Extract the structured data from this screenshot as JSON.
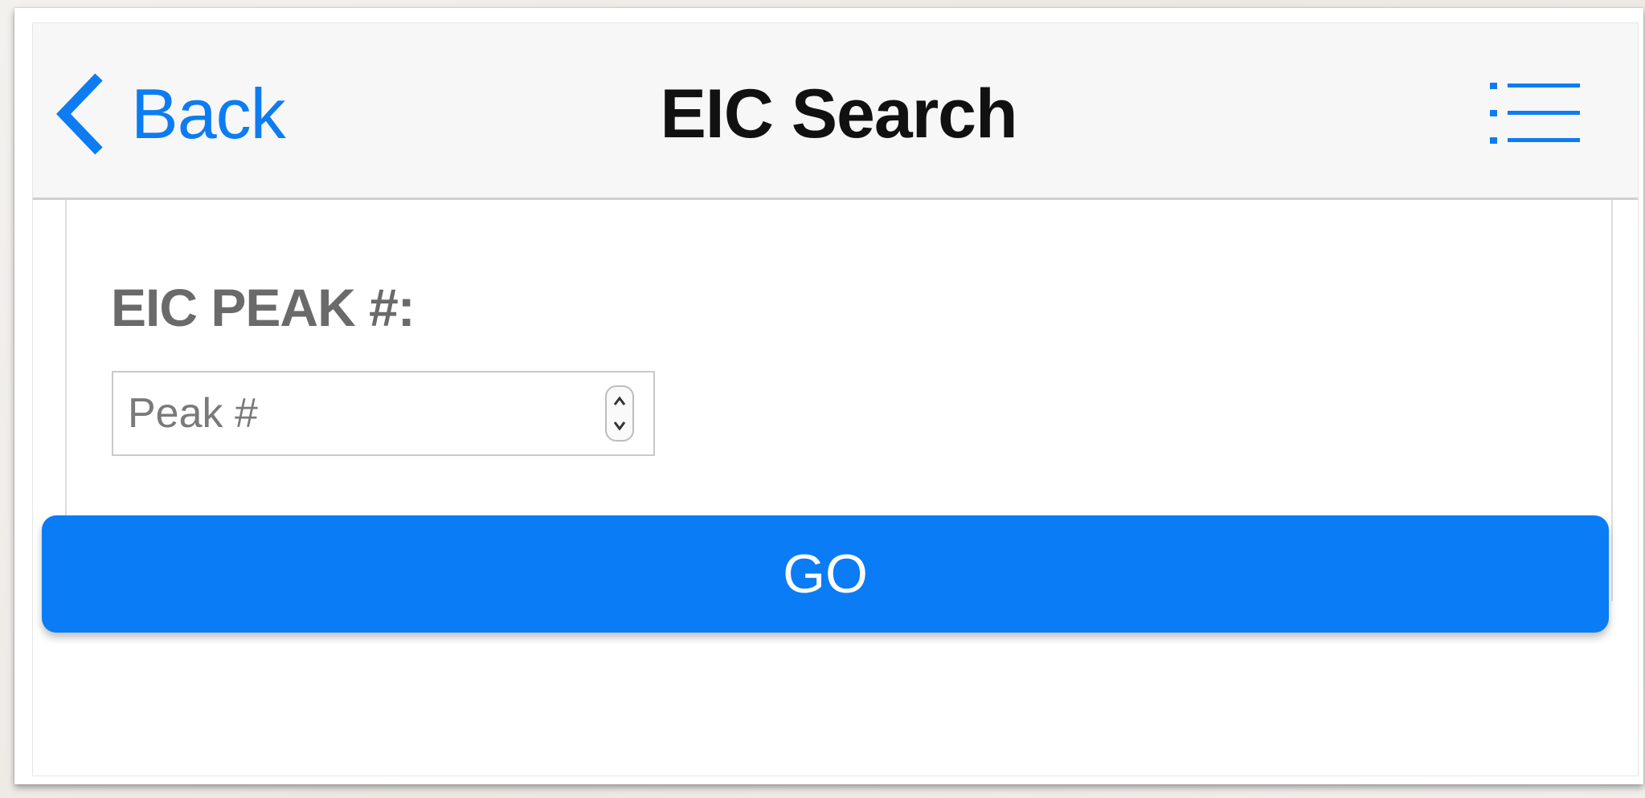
{
  "navbar": {
    "back_label": "Back",
    "title": "EIC Search",
    "back_icon": "chevron-left-icon",
    "menu_icon": "list-menu-icon"
  },
  "form": {
    "label": "EIC PEAK #:",
    "input": {
      "value": "",
      "placeholder": "Peak #"
    }
  },
  "actions": {
    "go_label": "GO"
  },
  "colors": {
    "accent": "#0a7cf5",
    "navbar_bg": "#f7f7f7",
    "label_gray": "#6a6a6a"
  }
}
